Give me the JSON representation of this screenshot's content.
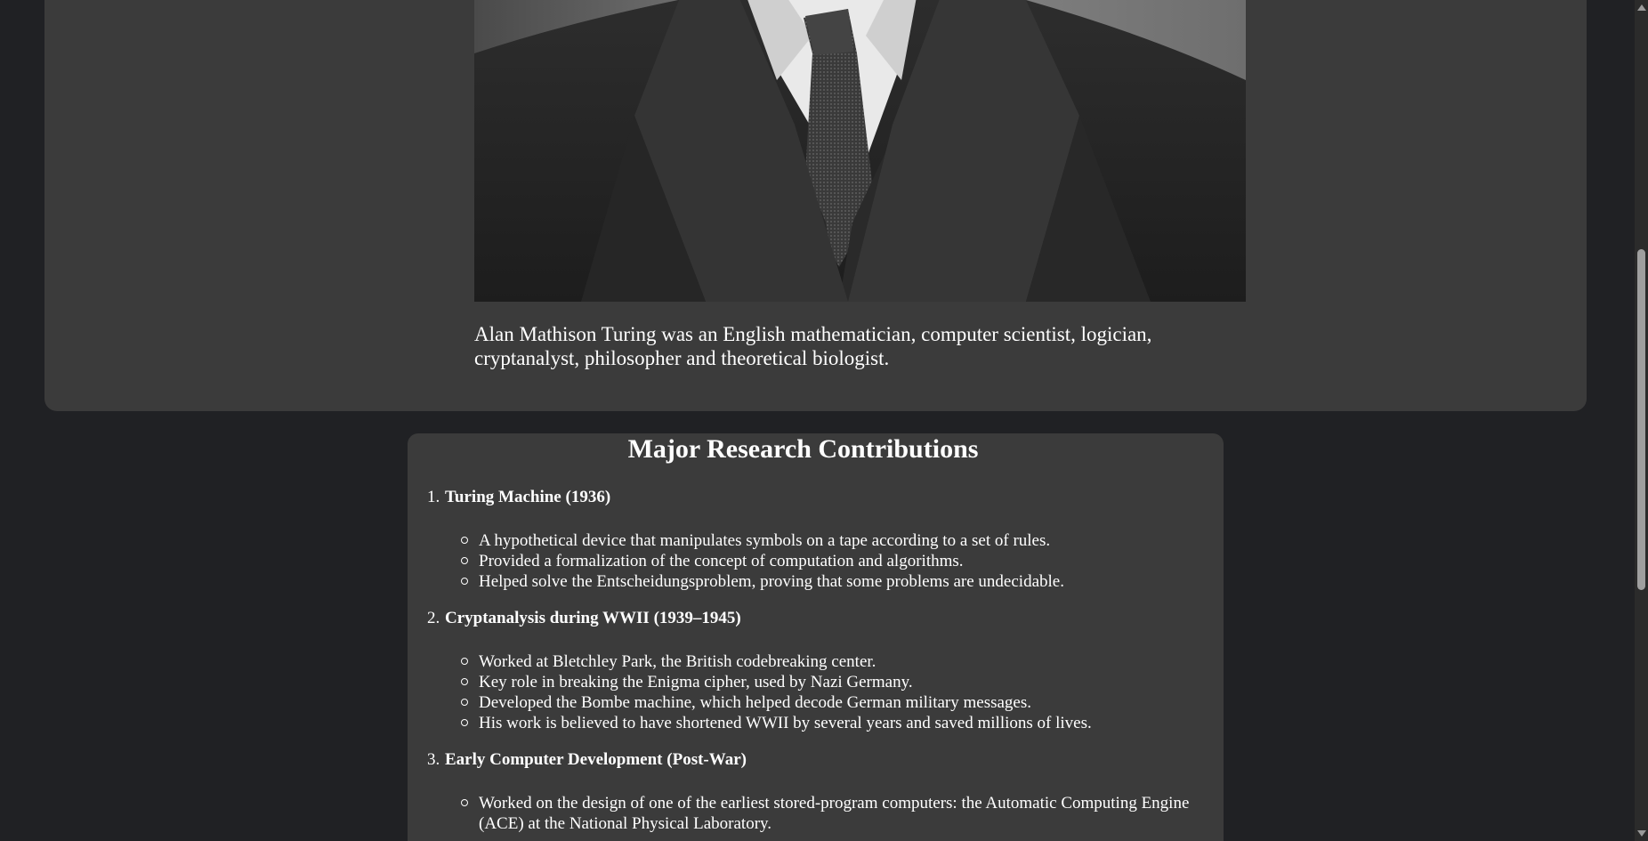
{
  "hero": {
    "portrait_alt": "Alan Turing portrait",
    "intro_text": "Alan Mathison Turing was an English mathematician, computer scientist, logician, cryptanalyst, philosopher and theoretical biologist."
  },
  "contributions": {
    "title": "Major Research Contributions",
    "items": [
      {
        "number": "1.",
        "name": "Turing Machine (1936)",
        "points": [
          "A hypothetical device that manipulates symbols on a tape according to a set of rules.",
          "Provided a formalization of the concept of computation and algorithms.",
          "Helped solve the Entscheidungsproblem, proving that some problems are undecidable."
        ]
      },
      {
        "number": "2.",
        "name": "Cryptanalysis during WWII (1939–1945)",
        "points": [
          "Worked at Bletchley Park, the British codebreaking center.",
          "Key role in breaking the Enigma cipher, used by Nazi Germany.",
          "Developed the Bombe machine, which helped decode German military messages.",
          "His work is believed to have shortened WWII by several years and saved millions of lives."
        ]
      },
      {
        "number": "3.",
        "name": "Early Computer Development (Post-War)",
        "points": [
          "Worked on the design of one of the earliest stored-program computers: the Automatic Computing Engine (ACE) at the National Physical Laboratory."
        ]
      }
    ]
  },
  "colors": {
    "page_background": "#202124",
    "card_background": "#3b3b3b",
    "text": "#ffffff"
  },
  "scroll": {
    "position_fraction": 0.35
  }
}
